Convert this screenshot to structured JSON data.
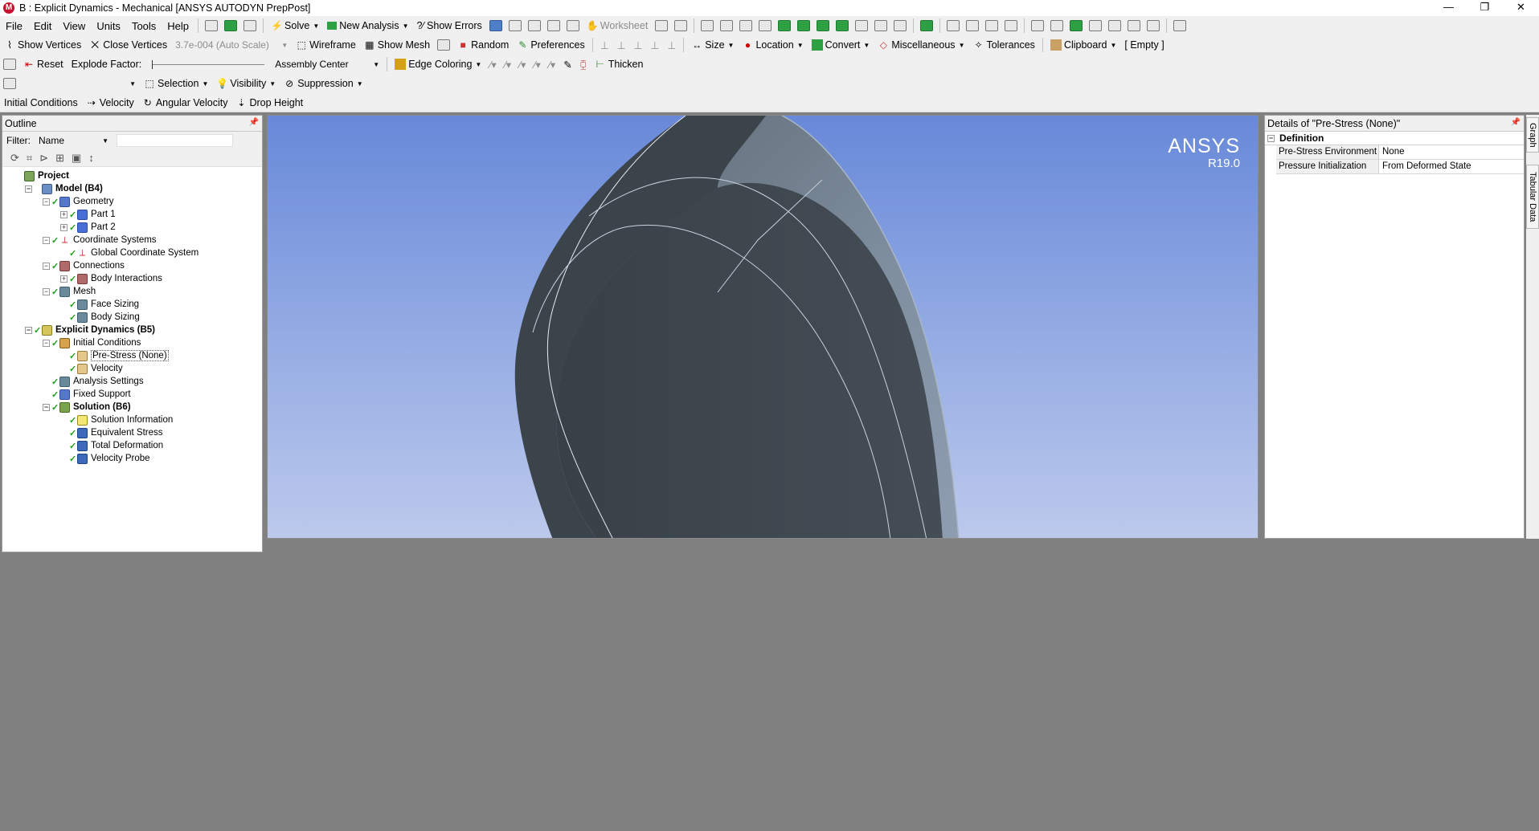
{
  "window": {
    "app_icon_letter": "M",
    "title": "B : Explicit Dynamics - Mechanical [ANSYS AUTODYN PrepPost]",
    "controls": [
      "—",
      "❐",
      "✕"
    ]
  },
  "menu": [
    "File",
    "Edit",
    "View",
    "Units",
    "Tools",
    "Help"
  ],
  "toolbar_main": {
    "solve": "Solve",
    "new_analysis": "New Analysis",
    "show_errors": "?⁄ Show Errors",
    "worksheet": "Worksheet"
  },
  "toolbar_graphics": {
    "show_vertices": "Show Vertices",
    "close_vertices": "Close Vertices",
    "scale_value": "3.7e-004 (Auto Scale)",
    "wireframe": "Wireframe",
    "show_mesh": "Show Mesh",
    "random": "Random",
    "preferences": "Preferences",
    "size": "Size",
    "location": "Location",
    "convert": "Convert",
    "miscellaneous": "Miscellaneous",
    "tolerances": "Tolerances",
    "clipboard": "Clipboard",
    "clipboard_state": "[ Empty ]"
  },
  "toolbar_explode": {
    "reset": "Reset",
    "explode_factor_label": "Explode Factor:",
    "assembly_center": "Assembly Center",
    "edge_coloring": "Edge Coloring",
    "thicken": "Thicken"
  },
  "toolbar_select": {
    "selection": "Selection",
    "visibility": "Visibility",
    "suppression": "Suppression"
  },
  "toolbar_context": {
    "initial_conditions": "Initial Conditions",
    "velocity": "Velocity",
    "angular_velocity": "Angular Velocity",
    "drop_height": "Drop Height"
  },
  "outline": {
    "title": "Outline",
    "filter_label": "Filter:",
    "filter_value": "Name",
    "tree": [
      {
        "label": "Project",
        "level": 0,
        "bold": true,
        "icon": "project-icon",
        "expander": "",
        "check": false
      },
      {
        "label": "Model (B4)",
        "level": 1,
        "bold": true,
        "icon": "model-icon",
        "expander": "−",
        "check": false
      },
      {
        "label": "Geometry",
        "level": 2,
        "bold": false,
        "icon": "geometry-icon",
        "expander": "−",
        "check": true
      },
      {
        "label": "Part 1",
        "level": 3,
        "bold": false,
        "icon": "part-icon",
        "expander": "+",
        "check": true
      },
      {
        "label": "Part 2",
        "level": 3,
        "bold": false,
        "icon": "part-icon",
        "expander": "+",
        "check": true
      },
      {
        "label": "Coordinate Systems",
        "level": 2,
        "bold": false,
        "icon": "coordinate-systems-icon",
        "expander": "−",
        "check": true
      },
      {
        "label": "Global Coordinate System",
        "level": 3,
        "bold": false,
        "icon": "coordinate-system-icon",
        "expander": "",
        "check": true
      },
      {
        "label": "Connections",
        "level": 2,
        "bold": false,
        "icon": "connections-icon",
        "expander": "−",
        "check": true
      },
      {
        "label": "Body Interactions",
        "level": 3,
        "bold": false,
        "icon": "body-interactions-icon",
        "expander": "+",
        "check": true
      },
      {
        "label": "Mesh",
        "level": 2,
        "bold": false,
        "icon": "mesh-icon",
        "expander": "−",
        "check": true
      },
      {
        "label": "Face Sizing",
        "level": 3,
        "bold": false,
        "icon": "face-sizing-icon",
        "expander": "",
        "check": true
      },
      {
        "label": "Body Sizing",
        "level": 3,
        "bold": false,
        "icon": "body-sizing-icon",
        "expander": "",
        "check": true
      },
      {
        "label": "Explicit Dynamics (B5)",
        "level": 1,
        "bold": true,
        "icon": "explicit-dynamics-icon",
        "expander": "−",
        "check": true
      },
      {
        "label": "Initial Conditions",
        "level": 2,
        "bold": false,
        "icon": "initial-conditions-icon",
        "expander": "−",
        "check": true
      },
      {
        "label": "Pre-Stress (None)",
        "level": 3,
        "bold": false,
        "icon": "pre-stress-icon",
        "expander": "",
        "check": true,
        "selected": true
      },
      {
        "label": "Velocity",
        "level": 3,
        "bold": false,
        "icon": "velocity-icon",
        "expander": "",
        "check": true
      },
      {
        "label": "Analysis Settings",
        "level": 2,
        "bold": false,
        "icon": "analysis-settings-icon",
        "expander": "",
        "check": true
      },
      {
        "label": "Fixed Support",
        "level": 2,
        "bold": false,
        "icon": "fixed-support-icon",
        "expander": "",
        "check": true
      },
      {
        "label": "Solution (B6)",
        "level": 2,
        "bold": true,
        "icon": "solution-icon",
        "expander": "−",
        "check": true
      },
      {
        "label": "Solution Information",
        "level": 3,
        "bold": false,
        "icon": "solution-information-icon",
        "expander": "",
        "check": true
      },
      {
        "label": "Equivalent Stress",
        "level": 3,
        "bold": false,
        "icon": "result-icon",
        "expander": "",
        "check": true
      },
      {
        "label": "Total Deformation",
        "level": 3,
        "bold": false,
        "icon": "result-icon",
        "expander": "",
        "check": true
      },
      {
        "label": "Velocity Probe",
        "level": 3,
        "bold": false,
        "icon": "probe-icon",
        "expander": "",
        "check": true
      }
    ]
  },
  "viewport": {
    "brand": "ANSYS",
    "version": "R19.0",
    "colors": {
      "bg_top": "#6889d9",
      "bg_bottom": "#bcc9ec",
      "face_dark": "#3a424a",
      "face_light": "#7f8fa0"
    }
  },
  "details": {
    "title": "Details of \"Pre-Stress (None)\"",
    "section": "Definition",
    "rows": [
      {
        "key": "Pre-Stress Environment",
        "value": "None"
      },
      {
        "key": "Pressure Initialization",
        "value": "From Deformed State"
      }
    ]
  },
  "side_tabs": [
    "Graph",
    "Tabular Data"
  ]
}
